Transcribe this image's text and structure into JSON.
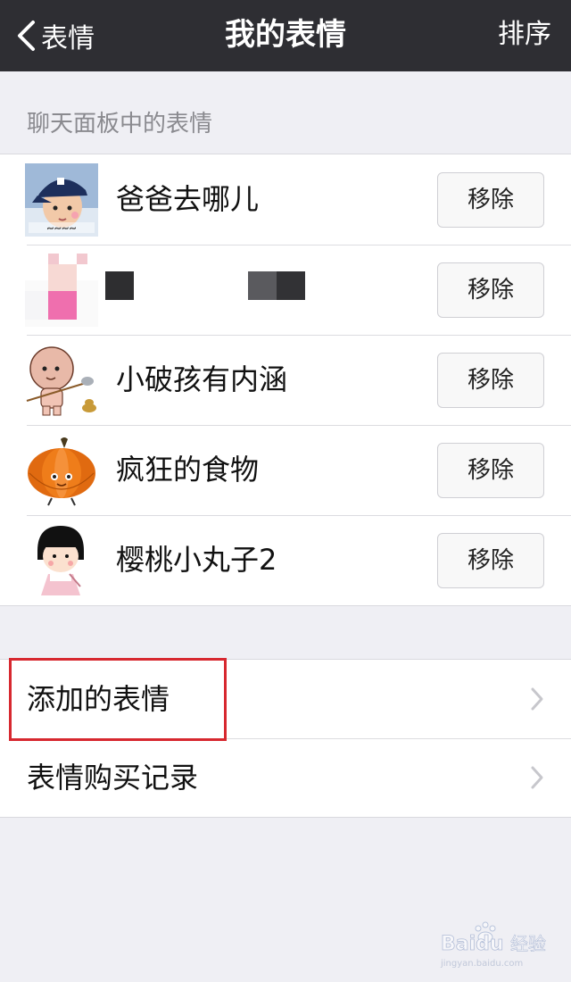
{
  "nav": {
    "back_label": "表情",
    "title": "我的表情",
    "sort_label": "排序"
  },
  "section_header": "聊天面板中的表情",
  "stickers": [
    {
      "name": "爸爸去哪儿",
      "remove_label": "移除",
      "thumb_icon": "boy-in-cap-sticker"
    },
    {
      "name": "",
      "remove_label": "移除",
      "thumb_icon": "pixelated-sticker"
    },
    {
      "name": "小破孩有内涵",
      "remove_label": "移除",
      "thumb_icon": "bald-kid-sticker"
    },
    {
      "name": "疯狂的食物",
      "remove_label": "移除",
      "thumb_icon": "pumpkin-sticker"
    },
    {
      "name": "樱桃小丸子2",
      "remove_label": "移除",
      "thumb_icon": "maruko-sticker"
    }
  ],
  "menu": [
    {
      "label": "添加的表情"
    },
    {
      "label": "表情购买记录"
    }
  ],
  "watermark": {
    "brand": "Baidu",
    "text": "经验",
    "url": "jingyan.baidu.com"
  },
  "colors": {
    "navbar": "#2e2e33",
    "background": "#efeff4",
    "highlight": "#d7282f"
  }
}
